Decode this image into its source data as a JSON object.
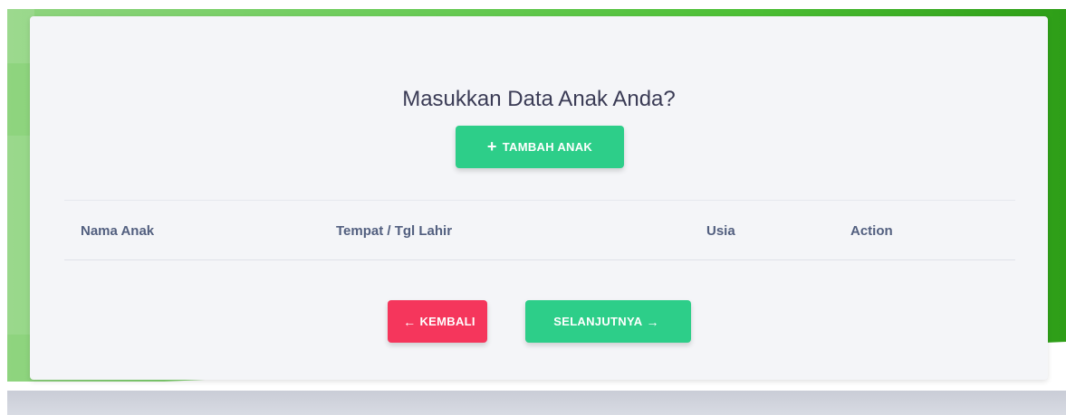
{
  "form": {
    "title": "Masukkan Data Anak Anda?",
    "add_button_icon": "plus-icon",
    "add_button_label": "TAMBAH ANAK",
    "table": {
      "headers": [
        "Nama Anak",
        "Tempat / Tgl Lahir",
        "Usia",
        "Action"
      ]
    },
    "back_button_label": "KEMBALI",
    "back_button_icon": "arrow-left-icon",
    "next_button_label": "SELANJUTNYA",
    "next_button_icon": "arrow-right-icon"
  },
  "colors": {
    "success": "#2dce89",
    "danger": "#f5365c",
    "background_green": "#4cbf35",
    "card": "#f4f5f8"
  }
}
